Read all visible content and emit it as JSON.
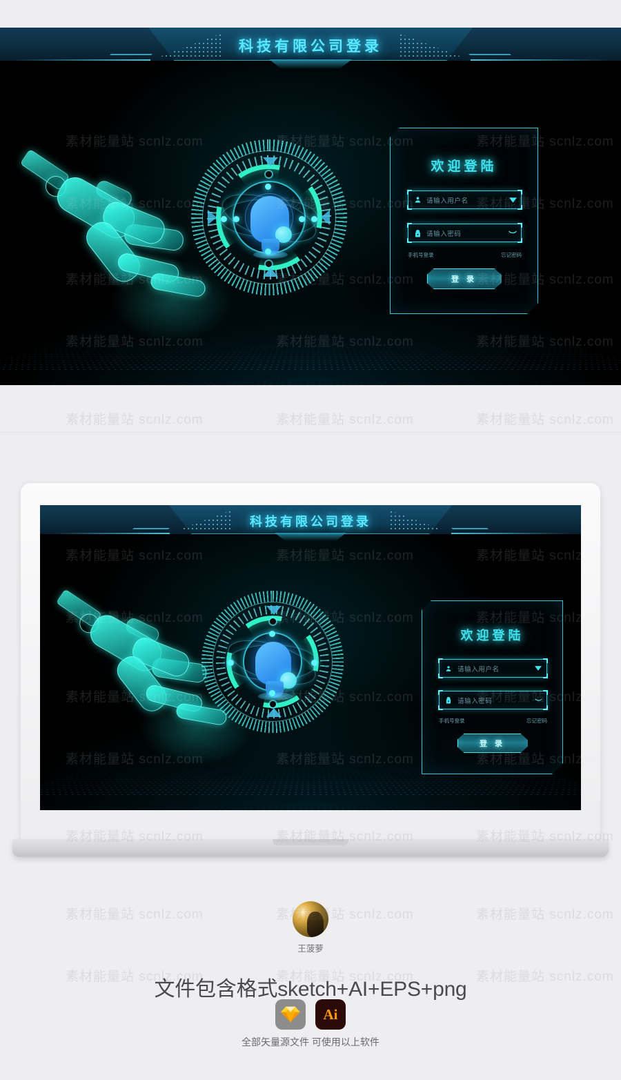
{
  "hero": {
    "header_title": "科技有限公司登录"
  },
  "login": {
    "title": "欢迎登陆",
    "username": {
      "icon": "user-icon",
      "placeholder": "请输入用户名",
      "value": "",
      "trailing_icon": "chevron-down-icon"
    },
    "password": {
      "icon": "lock-icon",
      "placeholder": "请输入密码",
      "value": "",
      "trailing_icon": "eye-closed-icon"
    },
    "phone_login_link": "手机号登录",
    "forgot_password_link": "忘记密码",
    "submit_label": "登 录"
  },
  "footer": {
    "author_name": "王菠萝",
    "promo_text": "文件包含格式sketch+AI+EPS+png",
    "note_text": "全部矢量源文件 可使用以上软件",
    "apps": [
      {
        "name": "Sketch",
        "label": ""
      },
      {
        "name": "Adobe Illustrator",
        "label": "Ai"
      }
    ]
  },
  "watermark": {
    "text": "素材能量站 scnlz.com"
  },
  "colors": {
    "accent_cyan": "#3fe6f2",
    "accent_teal": "#2ff0c6",
    "header_blue": "#14415c",
    "page_bg": "#eeeef0",
    "screen_bg": "#000000",
    "ai_orange": "#ff9a00"
  }
}
